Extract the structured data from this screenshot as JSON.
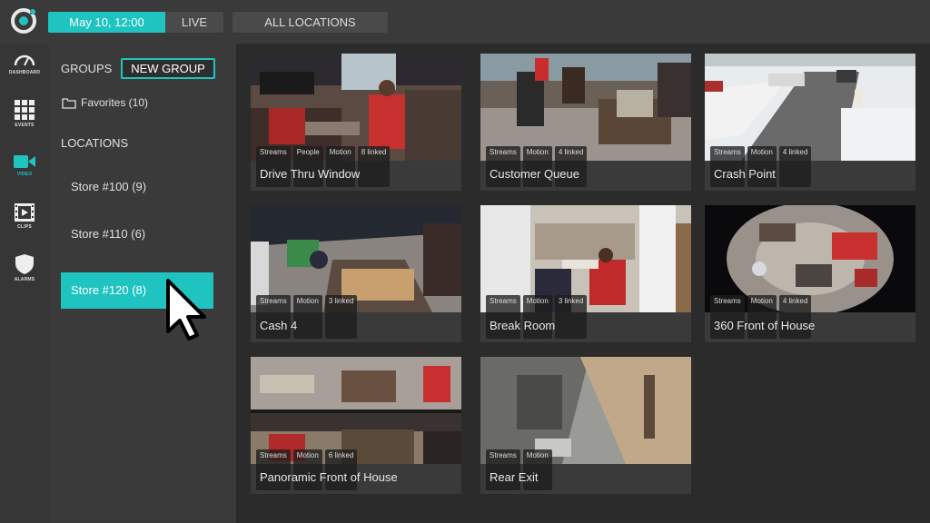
{
  "topbar": {
    "date": "May 10, 12:00",
    "live": "LIVE",
    "all_locations": "ALL LOCATIONS"
  },
  "nav": {
    "items": [
      {
        "label": "DASHBOARD",
        "icon": "gauge-icon"
      },
      {
        "label": "EVENTS",
        "icon": "grid-icon"
      },
      {
        "label": "VIDEO",
        "icon": "video-camera-icon"
      },
      {
        "label": "CLIPS",
        "icon": "film-icon"
      },
      {
        "label": "ALARMS",
        "icon": "shield-icon"
      }
    ]
  },
  "sidebar": {
    "groups_title": "GROUPS",
    "new_group": "NEW GROUP",
    "favorites": "Favorites (10)",
    "locations_title": "LOCATIONS",
    "stores": [
      {
        "label": "Store #100 (9)",
        "active": false
      },
      {
        "label": "Store #110 (6)",
        "active": false
      },
      {
        "label": "Store #120 (8)",
        "active": true
      }
    ]
  },
  "colors": {
    "accent": "#1fc3c0",
    "panel": "#3a3a3a",
    "background": "#2b2b2b"
  },
  "cameras": [
    {
      "title": "Drive Thru Window",
      "tags": [
        "Streams",
        "People",
        "Motion",
        "8 linked"
      ]
    },
    {
      "title": "Customer Queue",
      "tags": [
        "Streams",
        "Motion",
        "4 linked"
      ]
    },
    {
      "title": "Crash Point",
      "tags": [
        "Streams",
        "Motion",
        "4 linked"
      ]
    },
    {
      "title": "Cash 4",
      "tags": [
        "Streams",
        "Motion",
        "3 linked"
      ]
    },
    {
      "title": "Break Room",
      "tags": [
        "Streams",
        "Motion",
        "3 linked"
      ]
    },
    {
      "title": "360 Front of House",
      "tags": [
        "Streams",
        "Motion",
        "4 linked"
      ]
    },
    {
      "title": "Panoramic Front of House",
      "tags": [
        "Streams",
        "Motion",
        "6 linked"
      ]
    },
    {
      "title": "Rear Exit",
      "tags": [
        "Streams",
        "Motion"
      ]
    }
  ]
}
